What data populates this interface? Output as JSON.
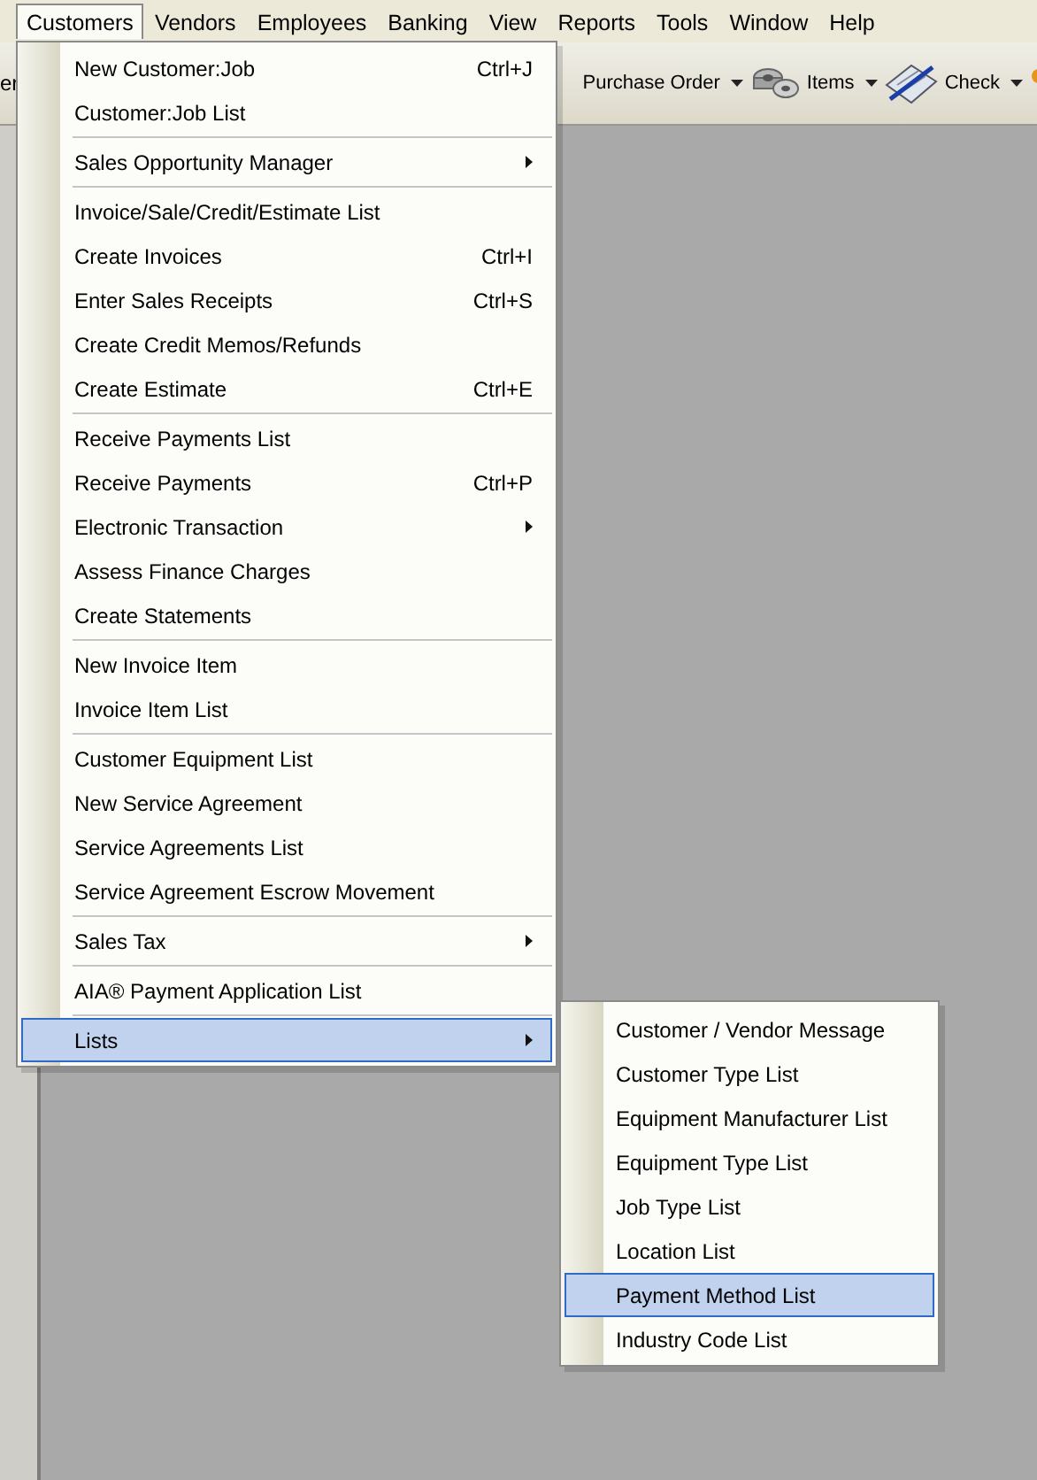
{
  "menubar": [
    {
      "label": "Customers",
      "selected": true
    },
    {
      "label": "Vendors",
      "selected": false
    },
    {
      "label": "Employees",
      "selected": false
    },
    {
      "label": "Banking",
      "selected": false
    },
    {
      "label": "View",
      "selected": false
    },
    {
      "label": "Reports",
      "selected": false
    },
    {
      "label": "Tools",
      "selected": false
    },
    {
      "label": "Window",
      "selected": false
    },
    {
      "label": "Help",
      "selected": false
    }
  ],
  "toolbar": {
    "cut_label": "er",
    "buttons": [
      {
        "label": "Purchase Order",
        "kind": "plain"
      },
      {
        "label": "Items",
        "kind": "items"
      },
      {
        "label": "Check",
        "kind": "check"
      }
    ]
  },
  "customers_menu": {
    "groups": [
      [
        {
          "label": "New Customer:Job",
          "shortcut": "Ctrl+J",
          "submenu": false,
          "selected": false
        },
        {
          "label": "Customer:Job List",
          "submenu": false,
          "selected": false
        }
      ],
      [
        {
          "label": "Sales Opportunity Manager",
          "submenu": true,
          "selected": false
        }
      ],
      [
        {
          "label": "Invoice/Sale/Credit/Estimate List",
          "submenu": false,
          "selected": false
        },
        {
          "label": "Create Invoices",
          "shortcut": "Ctrl+I",
          "submenu": false,
          "selected": false
        },
        {
          "label": "Enter Sales Receipts",
          "shortcut": "Ctrl+S",
          "submenu": false,
          "selected": false
        },
        {
          "label": "Create Credit Memos/Refunds",
          "submenu": false,
          "selected": false
        },
        {
          "label": "Create Estimate",
          "shortcut": "Ctrl+E",
          "submenu": false,
          "selected": false
        }
      ],
      [
        {
          "label": "Receive Payments List",
          "submenu": false,
          "selected": false
        },
        {
          "label": "Receive Payments",
          "shortcut": "Ctrl+P",
          "submenu": false,
          "selected": false
        },
        {
          "label": "Electronic Transaction",
          "submenu": true,
          "selected": false
        },
        {
          "label": "Assess Finance Charges",
          "submenu": false,
          "selected": false
        },
        {
          "label": "Create Statements",
          "submenu": false,
          "selected": false
        }
      ],
      [
        {
          "label": "New Invoice Item",
          "submenu": false,
          "selected": false
        },
        {
          "label": "Invoice Item List",
          "submenu": false,
          "selected": false
        }
      ],
      [
        {
          "label": "Customer Equipment List",
          "submenu": false,
          "selected": false
        },
        {
          "label": "New Service Agreement",
          "submenu": false,
          "selected": false
        },
        {
          "label": "Service Agreements List",
          "submenu": false,
          "selected": false
        },
        {
          "label": "Service Agreement Escrow Movement",
          "submenu": false,
          "selected": false
        }
      ],
      [
        {
          "label": "Sales Tax",
          "submenu": true,
          "selected": false
        }
      ],
      [
        {
          "label": "AIA® Payment Application List",
          "submenu": false,
          "selected": false
        }
      ],
      [
        {
          "label": "Lists",
          "submenu": true,
          "selected": true
        }
      ]
    ]
  },
  "lists_submenu": [
    {
      "label": "Customer / Vendor Message",
      "selected": false
    },
    {
      "label": "Customer Type List",
      "selected": false
    },
    {
      "label": "Equipment Manufacturer List",
      "selected": false
    },
    {
      "label": "Equipment Type List",
      "selected": false
    },
    {
      "label": "Job Type List",
      "selected": false
    },
    {
      "label": "Location List",
      "selected": false
    },
    {
      "label": "Payment Method List",
      "selected": true
    },
    {
      "label": "Industry Code List",
      "selected": false
    }
  ]
}
